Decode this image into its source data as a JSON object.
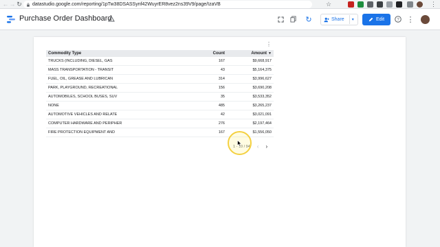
{
  "browser": {
    "url": "datastudio.google.com/reporting/1pTw38DSASSynf42WuyrER8vez2ns39V9/page/IzaVB"
  },
  "header": {
    "title": "Purchase Order Dashboard",
    "share_label": "Share",
    "edit_label": "Edit"
  },
  "table": {
    "columns": [
      "Commodity Type",
      "Count",
      "Amount"
    ],
    "rows": [
      {
        "type": "TRUCKS (INCLUDING, DIESEL, GAS",
        "count": "167",
        "amount": "$9,668,917"
      },
      {
        "type": "MASS TRANSPORTATION - TRANSIT",
        "count": "43",
        "amount": "$5,164,375"
      },
      {
        "type": "FUEL, OIL, GREASE AND LUBRICAN",
        "count": "314",
        "amount": "$3,996,627"
      },
      {
        "type": "PARK, PLAYGROUND, RECREATIONAL",
        "count": "156",
        "amount": "$3,690,208"
      },
      {
        "type": "AUTOMOBILES, SCHOOL BUSES, SUV",
        "count": "35",
        "amount": "$3,533,352"
      },
      {
        "type": "NONE",
        "count": "485",
        "amount": "$3,265,237"
      },
      {
        "type": "AUTOMOTIVE VEHICLES AND RELATE",
        "count": "42",
        "amount": "$3,021,091"
      },
      {
        "type": "COMPUTER HARDWARE AND PERIPHER",
        "count": "276",
        "amount": "$2,197,464"
      },
      {
        "type": "FIRE PROTECTION EQUIPMENT AND",
        "count": "167",
        "amount": "$1,556,050"
      }
    ],
    "pager": "1 - 10 / 94"
  },
  "colors": {
    "accent": "#1a73e8",
    "header_bg": "#e8eaed",
    "cursor": "#f4d03f"
  }
}
